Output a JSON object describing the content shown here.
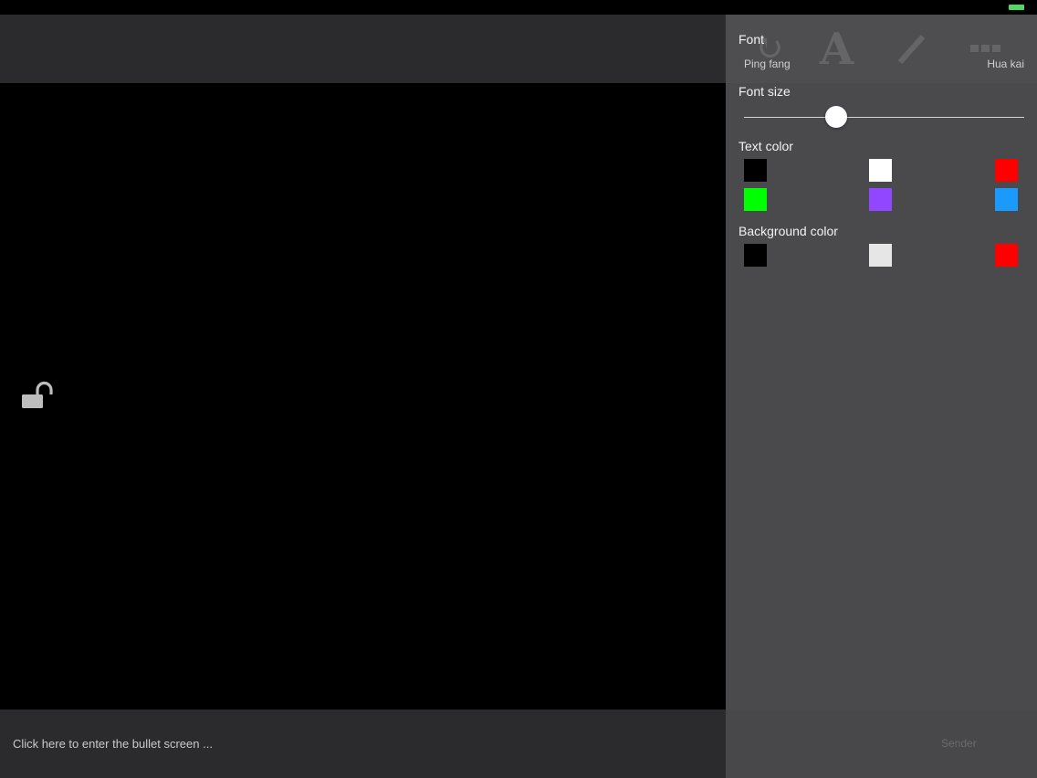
{
  "status_bar": {
    "battery_color": "#4cd964"
  },
  "stage": {
    "lock_icon": "unlocked-padlock-icon"
  },
  "bottom_bar": {
    "input_placeholder": "Click here to enter the bullet screen ..."
  },
  "panel": {
    "font": {
      "label": "Font",
      "options": [
        "Ping fang",
        "Hua kai"
      ]
    },
    "font_size": {
      "label": "Font size",
      "value_fraction": 0.33
    },
    "text_color": {
      "label": "Text color",
      "colors": [
        "#000000",
        "#ffffff",
        "#ff0000",
        "#00ff00",
        "#9146ff",
        "#1a9bfc"
      ]
    },
    "background_color": {
      "label": "Background color",
      "colors": [
        "#000000",
        "#e6e6e6",
        "#ff0000"
      ]
    }
  },
  "ghost": {
    "toolbar_icons": [
      "rotate-icon",
      "text-style-icon",
      "magic-wand-icon",
      "more-icon"
    ],
    "send_label": "Sender"
  }
}
